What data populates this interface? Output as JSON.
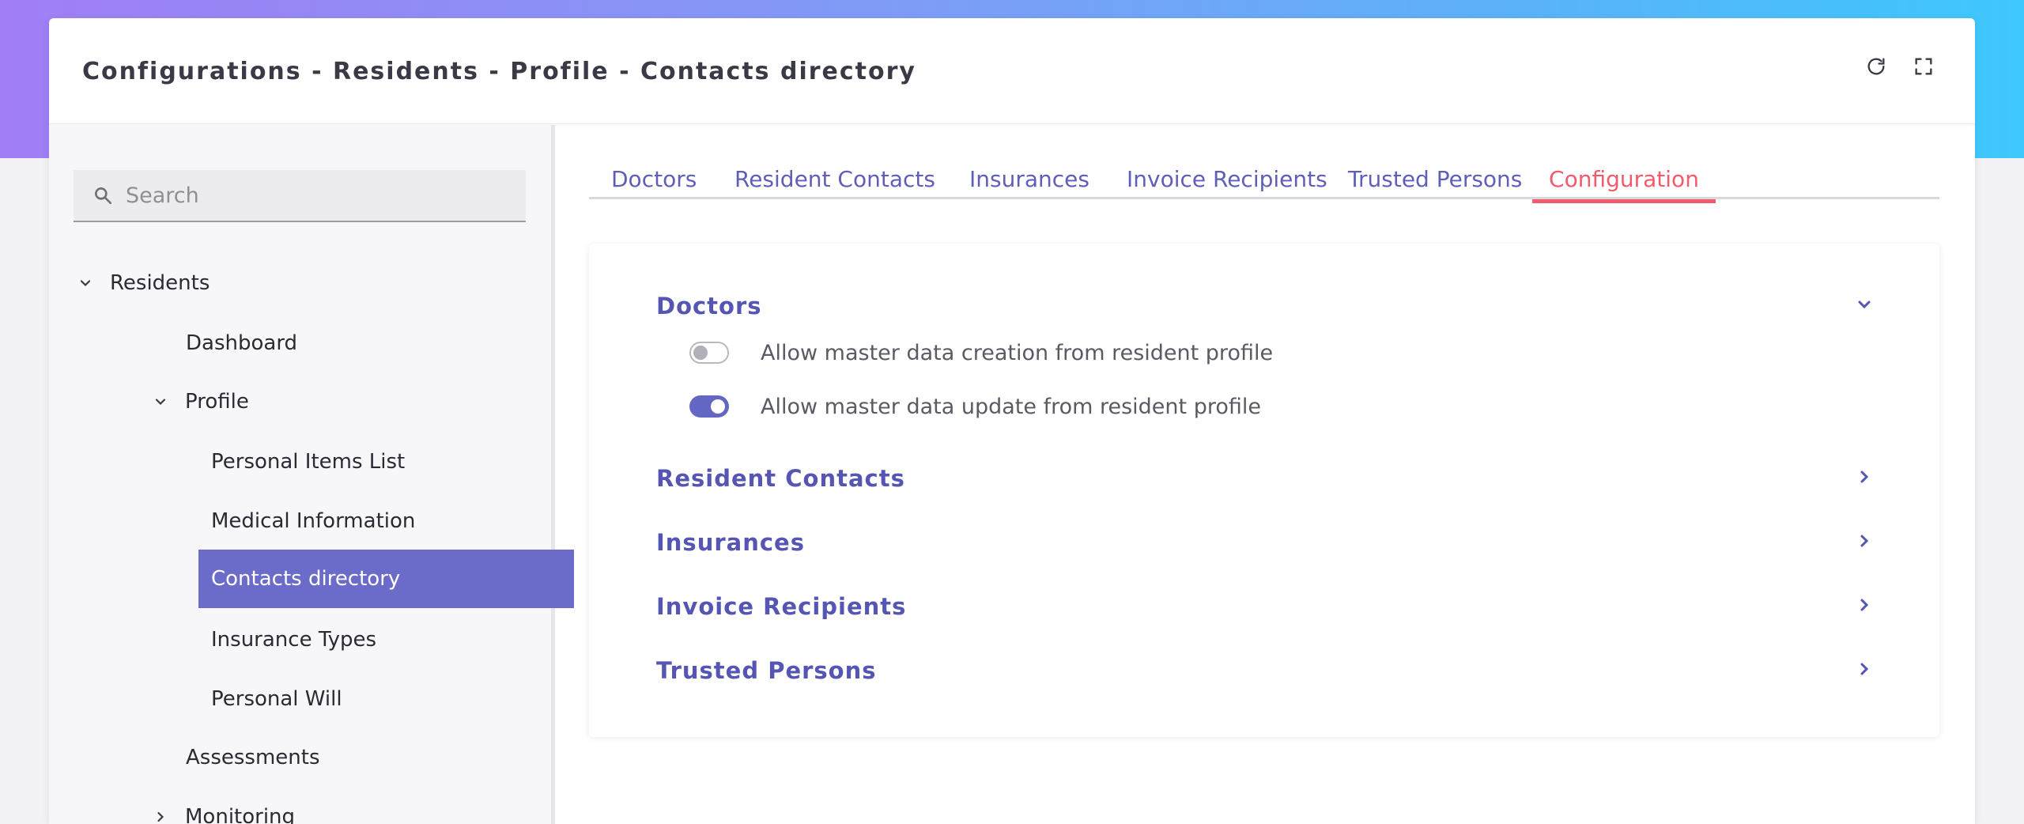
{
  "header": {
    "breadcrumb": "Configurations  -  Residents  -  Profile  -  Contacts directory"
  },
  "sidebar": {
    "search_placeholder": "Search",
    "items": [
      {
        "label": "Residents",
        "icon": "chevron-down-icon"
      },
      {
        "label": "Dashboard"
      },
      {
        "label": "Profile",
        "icon": "chevron-down-icon"
      },
      {
        "label": "Personal Items List"
      },
      {
        "label": "Medical Information"
      },
      {
        "label": "Contacts directory",
        "active": true
      },
      {
        "label": "Insurance Types"
      },
      {
        "label": "Personal Will"
      },
      {
        "label": "Assessments"
      },
      {
        "label": "Monitoring",
        "icon": "chevron-right-icon"
      }
    ]
  },
  "tabs": [
    {
      "label": "Doctors"
    },
    {
      "label": "Resident Contacts"
    },
    {
      "label": "Insurances"
    },
    {
      "label": "Invoice Recipients"
    },
    {
      "label": "Trusted Persons"
    },
    {
      "label": "Configuration",
      "active": true
    }
  ],
  "config": {
    "sections": [
      {
        "title": "Doctors",
        "expanded": true,
        "options": [
          {
            "label": "Allow master data creation from resident profile",
            "enabled": false
          },
          {
            "label": "Allow master data update from resident profile",
            "enabled": true
          }
        ]
      },
      {
        "title": "Resident Contacts",
        "expanded": false
      },
      {
        "title": "Insurances",
        "expanded": false
      },
      {
        "title": "Invoice Recipients",
        "expanded": false
      },
      {
        "title": "Trusted Persons",
        "expanded": false
      }
    ]
  },
  "colors": {
    "accent": "#6b6bc9",
    "active_tab": "#f25b6b",
    "link": "#5f5fb8"
  }
}
